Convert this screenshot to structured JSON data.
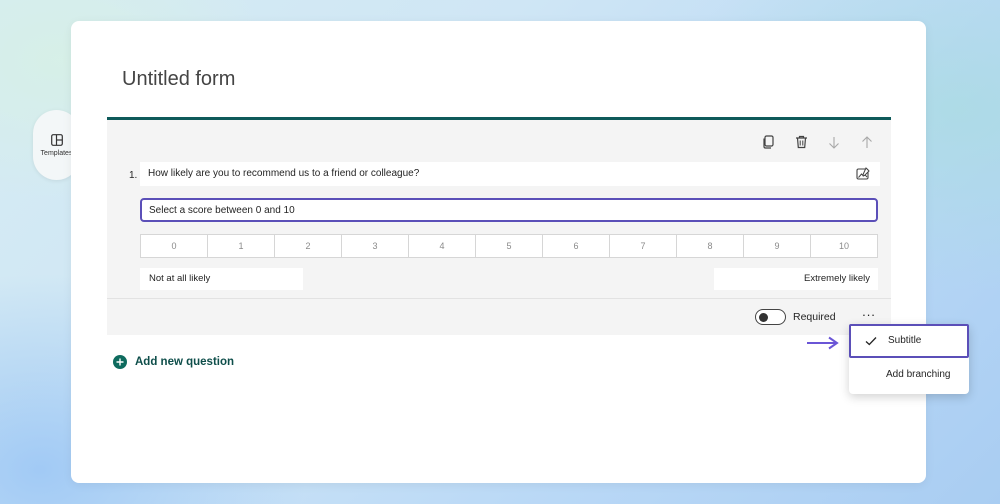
{
  "sidebar": {
    "templates_label": "Templates"
  },
  "form": {
    "title": "Untitled form"
  },
  "question": {
    "number": "1.",
    "text": "How likely are you to recommend us to a friend or colleague?",
    "subtitle_value": "Select a score between 0 and 10",
    "scale": [
      "0",
      "1",
      "2",
      "3",
      "4",
      "5",
      "6",
      "7",
      "8",
      "9",
      "10"
    ],
    "low_label": "Not at all likely",
    "high_label": "Extremely likely",
    "required_label": "Required",
    "required_on": false,
    "more_label": "..."
  },
  "add_question_label": "Add new question",
  "menu": {
    "items": [
      {
        "label": "Subtitle",
        "checked": true
      },
      {
        "label": "Add branching",
        "checked": false
      }
    ]
  },
  "colors": {
    "accent": "#5b4fb8",
    "brand": "#0e5a5a",
    "plus": "#0e6b5e",
    "arrow": "#6a55d6"
  }
}
